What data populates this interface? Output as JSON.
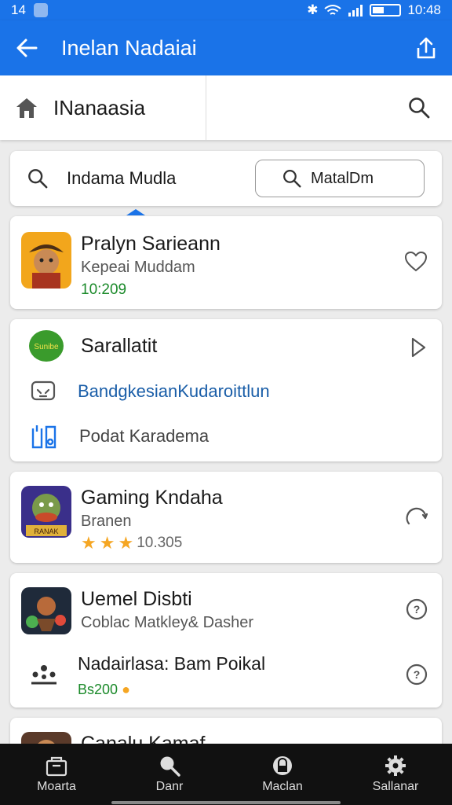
{
  "status": {
    "time_left": "14",
    "time_right": "10:48"
  },
  "appbar": {
    "title": "Inelan Nadaiai"
  },
  "tabbar": {
    "label": "INanaasia"
  },
  "search": {
    "query": "Indama Mudla",
    "button_label": "MatalDm"
  },
  "cards": [
    {
      "title": "Pralyn Sarieann",
      "subtitle": "Kepeai Muddam",
      "meta": "10:209",
      "action_icon": "heart-icon"
    },
    {
      "title": "Sarallatit",
      "link": "BandgkesianKudaroittlun",
      "sub_row": "Podat Karadema",
      "icon_text": "Sunibe",
      "action_icon": "chevron-right-icon"
    },
    {
      "title": "Gaming Kndaha",
      "subtitle": "Branen",
      "rating": "10.305",
      "icon_text": "RANAK",
      "action_icon": "refresh-icon"
    },
    {
      "title": "Uemel Disbti",
      "subtitle": "Coblac Matkley& Dasher",
      "row2_title": "Nadairlasa: Bam Poikal",
      "row2_meta": "Bs200",
      "action_icon": "help-icon"
    },
    {
      "title": "Canalu Kamaf"
    }
  ],
  "bottomnav": [
    "Moarta",
    "Danr",
    "Maclan",
    "Sallanar"
  ],
  "colors": {
    "primary": "#1a73e8",
    "link": "#1a5ea8",
    "green_meta": "#1b8a2a",
    "nav_bg": "#111111"
  }
}
